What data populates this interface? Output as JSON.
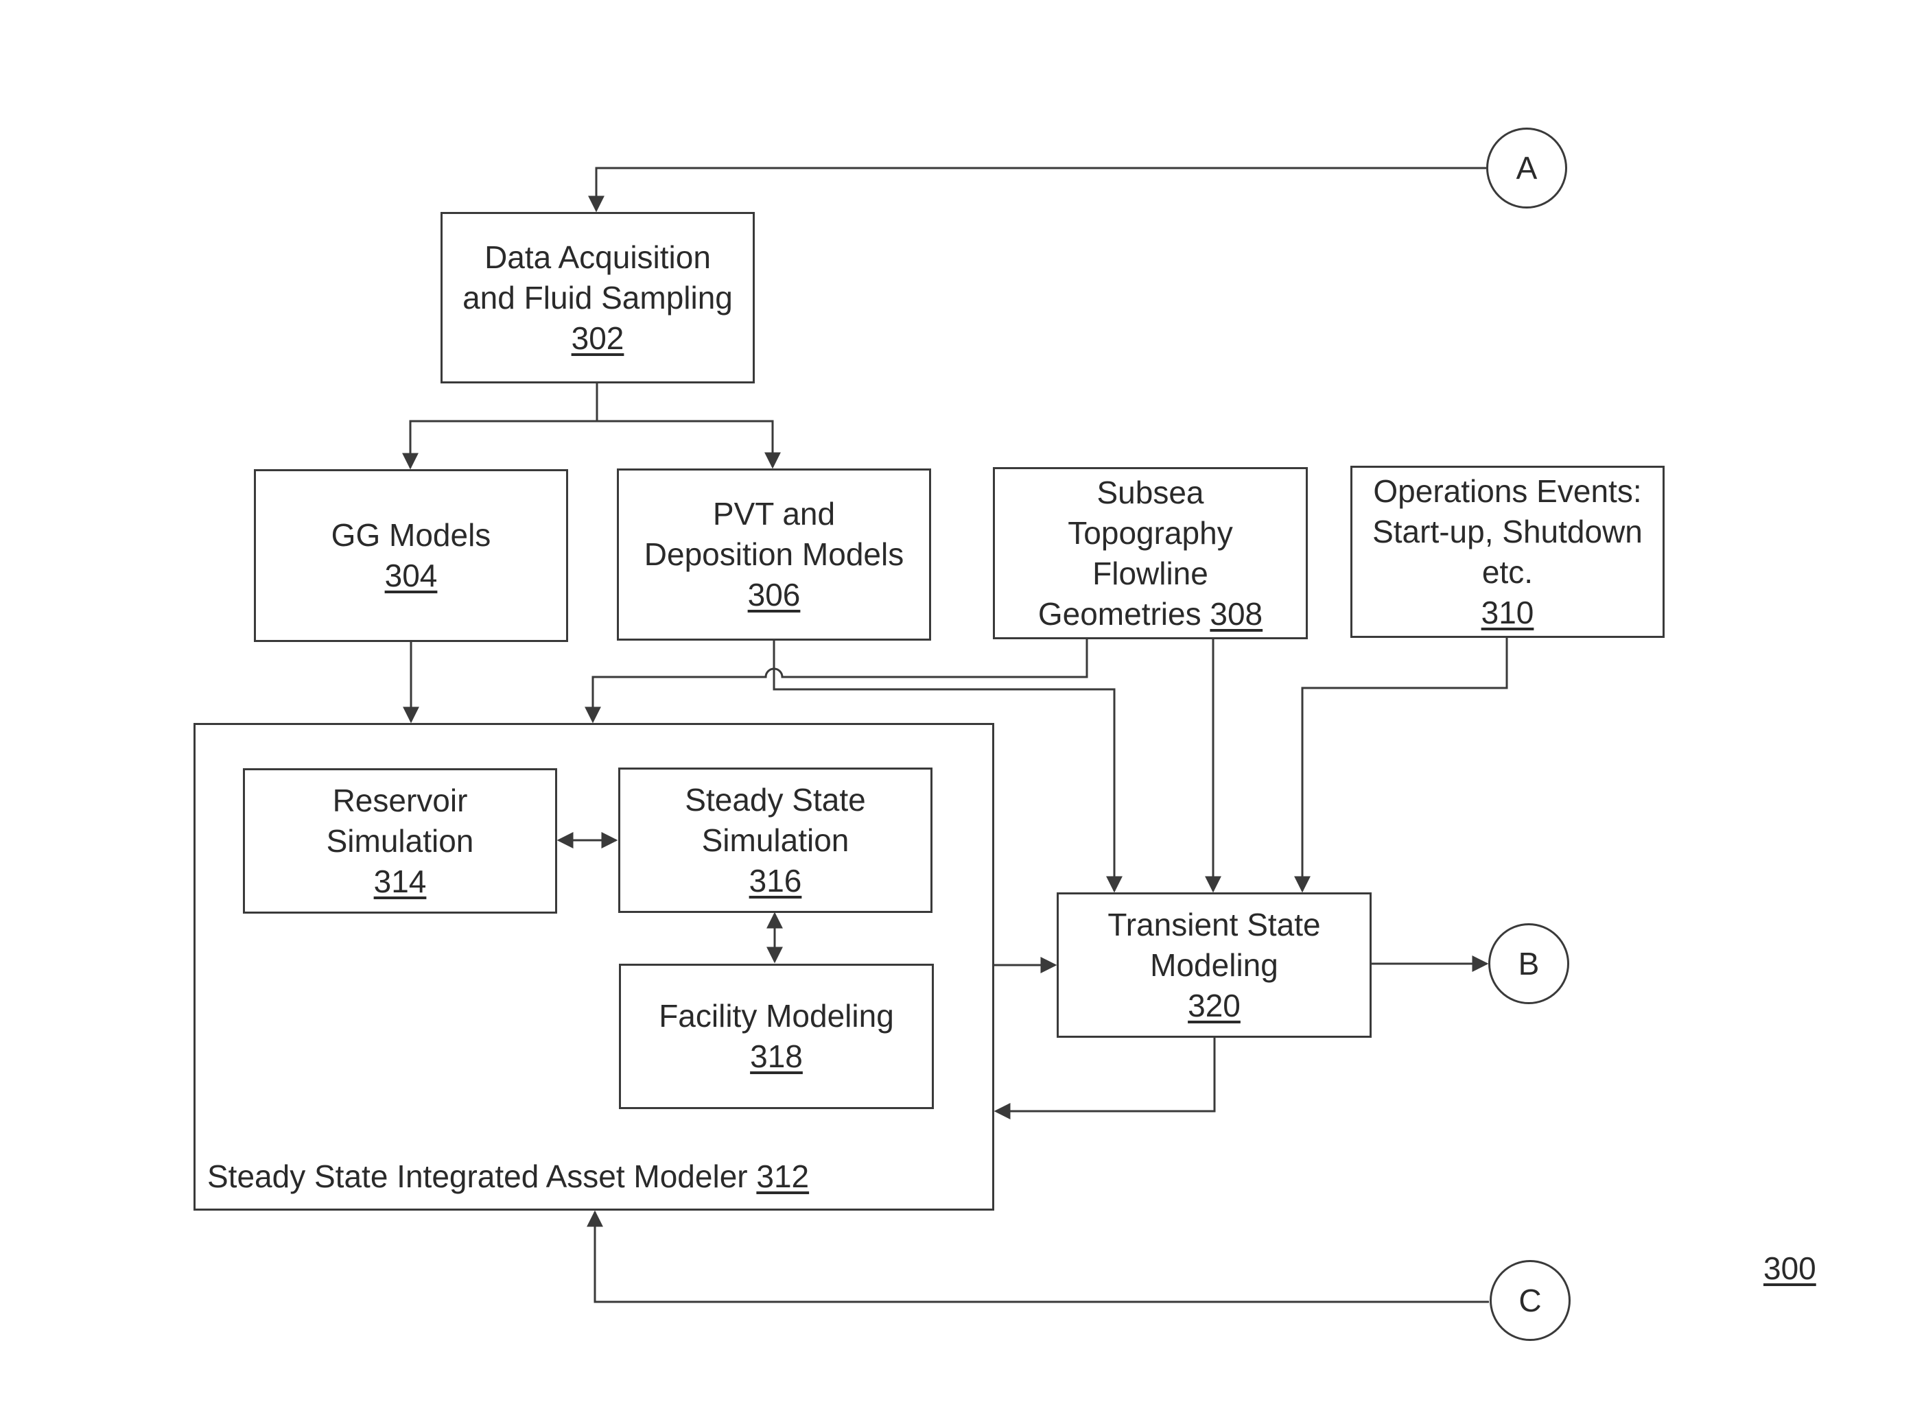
{
  "figure_number": "300",
  "connectors": {
    "a": "A",
    "b": "B",
    "c": "C"
  },
  "boxes": {
    "b302": {
      "lines": [
        "Data Acquisition",
        "and Fluid Sampling"
      ],
      "ref": "302"
    },
    "b304": {
      "lines": [
        "GG Models"
      ],
      "ref": "304"
    },
    "b306": {
      "lines": [
        "PVT and",
        "Deposition Models"
      ],
      "ref": "306"
    },
    "b308": {
      "lines": [
        "Subsea",
        "Topography",
        "Flowline"
      ],
      "last_line": "Geometries",
      "ref": "308"
    },
    "b310": {
      "lines": [
        "Operations Events:",
        "Start-up, Shutdown",
        "etc."
      ],
      "ref": "310"
    },
    "b314": {
      "lines": [
        "Reservoir",
        "Simulation"
      ],
      "ref": "314"
    },
    "b316": {
      "lines": [
        "Steady State",
        "Simulation"
      ],
      "ref": "316"
    },
    "b318": {
      "lines": [
        "Facility Modeling"
      ],
      "ref": "318"
    },
    "b320": {
      "lines": [
        "Transient State",
        "Modeling"
      ],
      "ref": "320"
    }
  },
  "container_312": {
    "label": "Steady State Integrated Asset Modeler",
    "ref": "312"
  },
  "edges": [
    {
      "from": "A",
      "to": "302"
    },
    {
      "from": "302",
      "to": "304"
    },
    {
      "from": "302",
      "to": "306"
    },
    {
      "from": "304",
      "to": "312"
    },
    {
      "from": "308",
      "to": "312"
    },
    {
      "from": "306",
      "to": "320"
    },
    {
      "from": "308",
      "to": "320"
    },
    {
      "from": "310",
      "to": "320"
    },
    {
      "from": "314",
      "to": "316",
      "bidirectional": true
    },
    {
      "from": "316",
      "to": "318",
      "bidirectional": true
    },
    {
      "from": "312",
      "to": "320"
    },
    {
      "from": "320",
      "to": "312"
    },
    {
      "from": "320",
      "to": "B"
    },
    {
      "from": "C",
      "to": "312"
    }
  ],
  "colors": {
    "line": "#3a3a3a",
    "text": "#2a2a2a",
    "background": "#ffffff"
  }
}
